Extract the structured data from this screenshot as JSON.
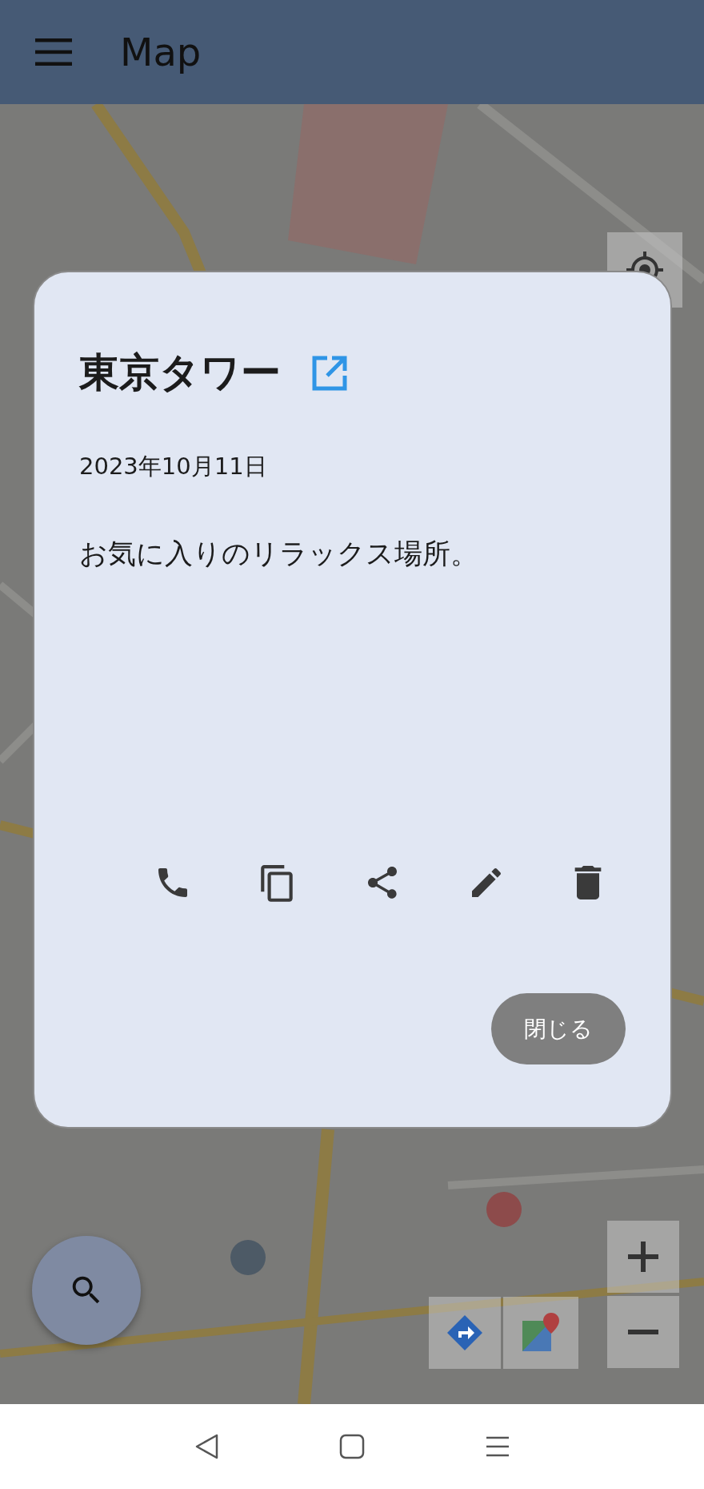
{
  "app_bar": {
    "title": "Map"
  },
  "dialog": {
    "title": "東京タワー",
    "date": "2023年10月11日",
    "description": "お気に入りのリラックス場所。",
    "close_button": "閉じる"
  }
}
